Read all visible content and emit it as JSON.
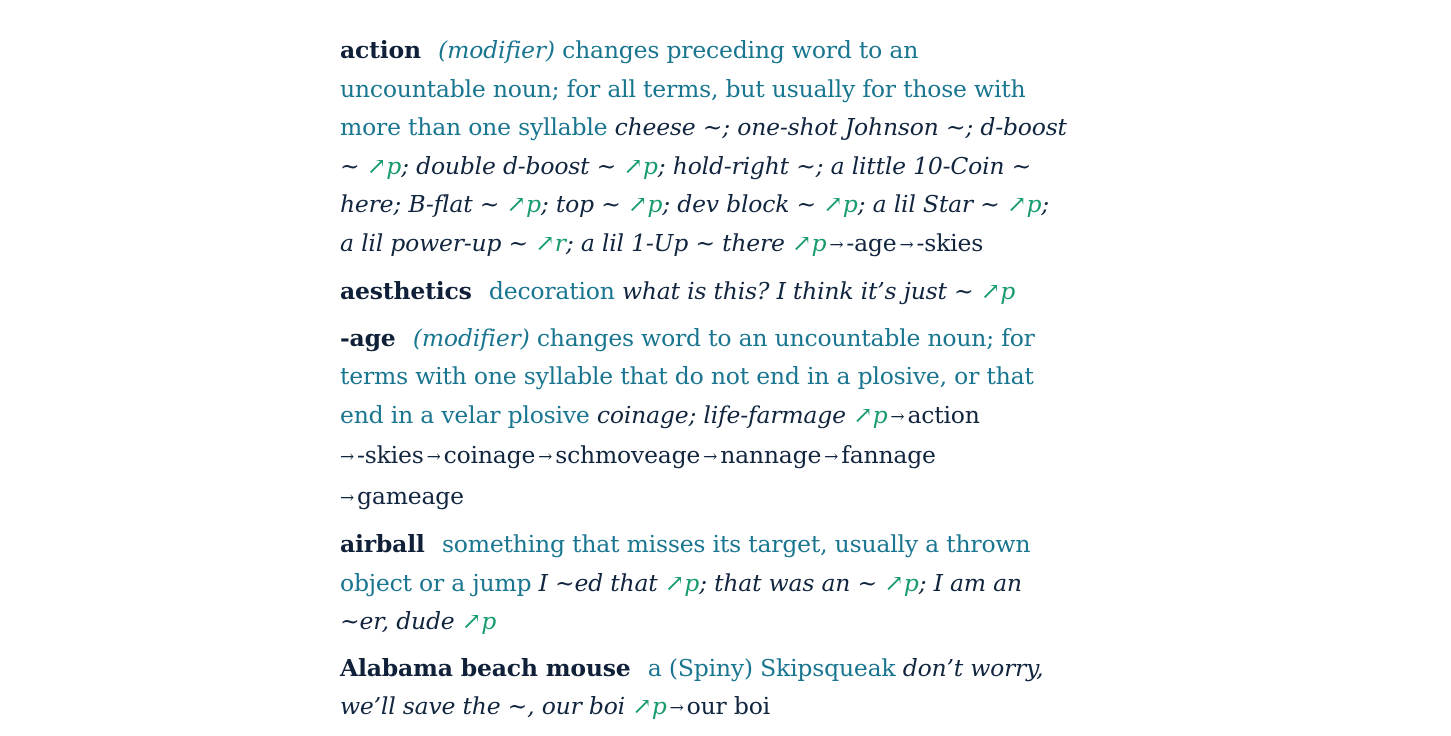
{
  "entries": [
    {
      "id": "action",
      "headword": "action",
      "pos": "(modifier)",
      "definition": "changes preceding word to an uncountable noun; for all terms, but usually for those with more than one syllable",
      "segments": [
        {
          "t": "ex",
          "v": "cheese ~; one-shot Johnson ~; d-boost ~ "
        },
        {
          "t": "mark",
          "v": "↗p"
        },
        {
          "t": "ex",
          "v": "; double d-boost ~ "
        },
        {
          "t": "mark",
          "v": "↗p"
        },
        {
          "t": "ex",
          "v": "; hold-right ~; a little 10-Coin ~ here; B-flat ~ "
        },
        {
          "t": "mark",
          "v": "↗p"
        },
        {
          "t": "ex",
          "v": "; top ~ "
        },
        {
          "t": "mark",
          "v": "↗p"
        },
        {
          "t": "ex",
          "v": "; dev block ~ "
        },
        {
          "t": "mark",
          "v": "↗p"
        },
        {
          "t": "ex",
          "v": "; a lil Star ~ "
        },
        {
          "t": "mark",
          "v": "↗p"
        },
        {
          "t": "ex",
          "v": "; a lil power-up ~ "
        },
        {
          "t": "mark",
          "v": "↗r"
        },
        {
          "t": "ex",
          "v": "; a lil 1-Up ~ there "
        },
        {
          "t": "mark",
          "v": "↗p"
        },
        {
          "t": "ref",
          "v": "-age"
        },
        {
          "t": "ref",
          "v": "-skies"
        }
      ]
    },
    {
      "id": "aesthetics",
      "headword": "aesthetics",
      "pos": "",
      "definition": "decoration",
      "segments": [
        {
          "t": "ex",
          "v": "what is this? I think it’s just ~ "
        },
        {
          "t": "mark",
          "v": "↗p"
        }
      ]
    },
    {
      "id": "age",
      "headword": "-age",
      "pos": "(modifier)",
      "definition": "changes word to an uncountable noun; for terms with one syllable that do not end in a plosive, or that end in a velar plosive",
      "segments": [
        {
          "t": "ex",
          "v": "coinage; life-farmage "
        },
        {
          "t": "mark",
          "v": "↗p"
        },
        {
          "t": "ref",
          "v": "action"
        },
        {
          "t": "ref",
          "v": "-skies"
        },
        {
          "t": "ref",
          "v": "coinage"
        },
        {
          "t": "ref",
          "v": "schmoveage"
        },
        {
          "t": "ref",
          "v": "nannage"
        },
        {
          "t": "ref",
          "v": "fannage"
        },
        {
          "t": "ref",
          "v": "gameage"
        }
      ]
    },
    {
      "id": "airball",
      "headword": "airball",
      "pos": "",
      "definition": "something that misses its target, usually a thrown object or a jump",
      "segments": [
        {
          "t": "ex",
          "v": "I ~ed that "
        },
        {
          "t": "mark",
          "v": "↗p"
        },
        {
          "t": "ex",
          "v": "; that was an ~ "
        },
        {
          "t": "mark",
          "v": "↗p"
        },
        {
          "t": "ex",
          "v": "; I am an ~er, dude "
        },
        {
          "t": "mark",
          "v": "↗p"
        }
      ]
    },
    {
      "id": "alabama-beach-mouse",
      "headword": "Alabama beach mouse",
      "pos": "",
      "definition": "a (Spiny) Skipsqueak",
      "segments": [
        {
          "t": "ex",
          "v": "don’t worry, we’ll save the ~, our boi "
        },
        {
          "t": "mark",
          "v": "↗p"
        },
        {
          "t": "ref",
          "v": "our boi"
        }
      ]
    }
  ],
  "arrow_glyph": "→",
  "colors": {
    "headword": "#0f2038",
    "definition": "#1a7690",
    "example": "#11253f",
    "mark": "#189c6e"
  }
}
